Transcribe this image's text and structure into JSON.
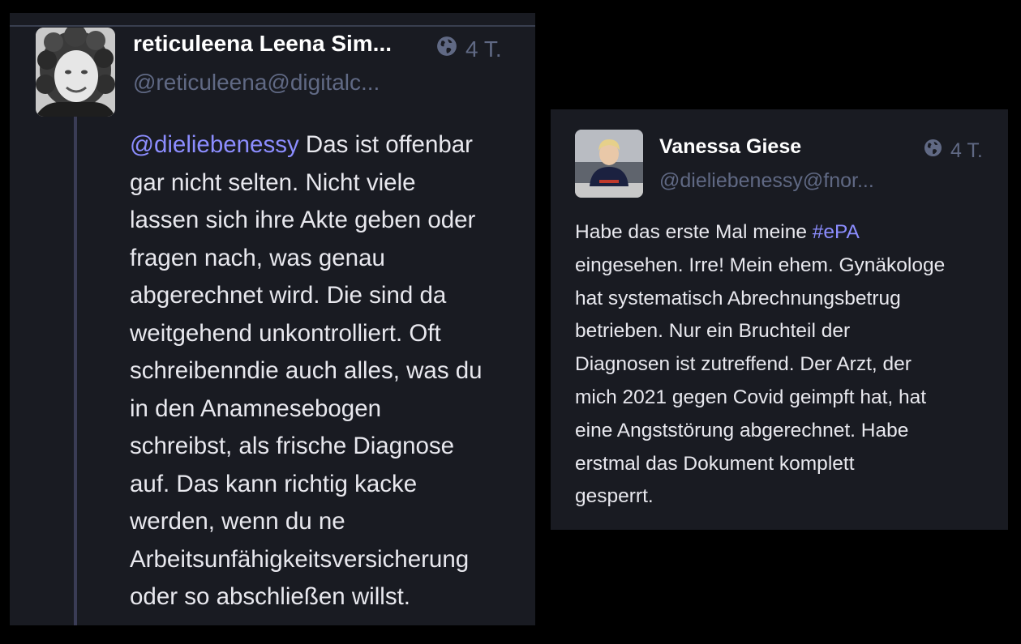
{
  "posts": [
    {
      "display_name": "reticuleena Leena Sim...",
      "handle": "@reticuleena@digitalc...",
      "time": "4 T.",
      "visibility_icon": "globe-icon",
      "body_lines": [
        {
          "mention": "@dieliebenessy",
          "text": " Das ist offenbar"
        },
        {
          "text": "gar nicht selten. Nicht viele"
        },
        {
          "text": "lassen sich ihre Akte geben oder"
        },
        {
          "text": "fragen nach, was genau"
        },
        {
          "text": "abgerechnet wird. Die sind da"
        },
        {
          "text": "weitgehend unkontrolliert. Oft"
        },
        {
          "text": "schreibenndie auch alles, was du"
        },
        {
          "text": "in den Anamnesebogen"
        },
        {
          "text": "schreibst, als frische Diagnose"
        },
        {
          "text": "auf. Das kann richtig kacke"
        },
        {
          "text": "werden, wenn du ne"
        },
        {
          "text": "Arbeitsunfähigkeitsversicherung"
        },
        {
          "text": "oder so abschließen willst."
        }
      ]
    },
    {
      "display_name": "Vanessa Giese",
      "handle": "@dieliebenessy@fnor...",
      "time": "4 T.",
      "visibility_icon": "globe-icon",
      "body_lines": [
        {
          "text": "Habe das erste Mal meine ",
          "hashtag": "#ePA"
        },
        {
          "text": "eingesehen. Irre! Mein ehem. Gynäkologe"
        },
        {
          "text": "hat systematisch Abrechnungsbetrug"
        },
        {
          "text": "betrieben. Nur ein Bruchteil der"
        },
        {
          "text": "Diagnosen ist zutreffend. Der Arzt, der"
        },
        {
          "text": "mich 2021 gegen Covid geimpft hat, hat"
        },
        {
          "text": "eine Angststörung abgerechnet. Habe"
        },
        {
          "text": "erstmal das Dokument komplett"
        },
        {
          "text": "gesperrt."
        }
      ]
    }
  ],
  "colors": {
    "background": "#000000",
    "card": "#191b22",
    "text": "#e8e8ee",
    "muted": "#606984",
    "link": "#8c8dff",
    "thread_line": "#3a3c55"
  }
}
